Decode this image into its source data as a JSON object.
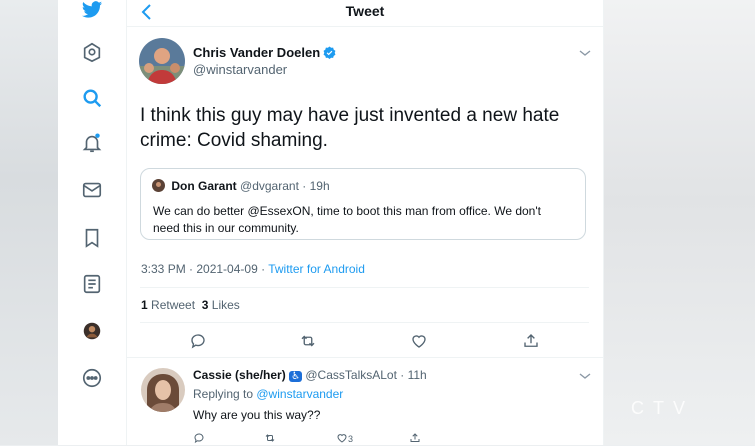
{
  "header": {
    "title": "Tweet"
  },
  "sidebar": {
    "icons": [
      "twitter-logo-icon",
      "home-icon",
      "search-icon",
      "bell-icon",
      "mail-icon",
      "bookmark-icon",
      "list-icon",
      "profile-avatar",
      "more-icon"
    ]
  },
  "tweet": {
    "author_name": "Chris Vander Doelen",
    "author_handle": "@winstarvander",
    "text": "I think this guy may have just invented a new hate crime: Covid shaming.",
    "quote": {
      "name": "Don Garant",
      "handle": "@dvgarant",
      "time": "· 19h",
      "text": "We can do better @EssexON, time to boot this man from office.  We don't need this in our community."
    },
    "timestamp": "3:33 PM · 2021-04-09 · ",
    "source": "Twitter for Android",
    "retweet_count": "1",
    "retweet_label": "Retweet",
    "like_count": "3",
    "like_label": "Likes"
  },
  "reply": {
    "name": "Cassie (she/her)",
    "badge": "♿",
    "handle": "@CassTalksALot",
    "time": "· 11h",
    "replying_prefix": "Replying to ",
    "replying_to": "@winstarvander",
    "text": "Why are you this way??",
    "like_count": "3"
  },
  "watermark": "CTV",
  "colors": {
    "accent": "#1d9bf0",
    "muted": "#536471",
    "text": "#0f1419",
    "border": "#eff3f4"
  }
}
